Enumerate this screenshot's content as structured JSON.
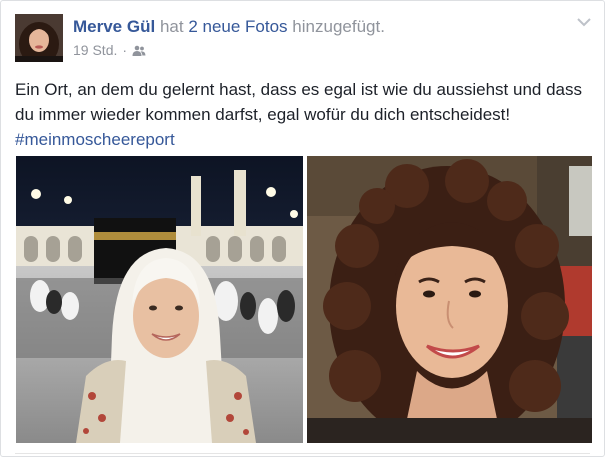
{
  "post": {
    "author": "Merve Gül",
    "action_prefix": "hat",
    "photos_link": "2 neue Fotos",
    "action_suffix": "hinzugefügt.",
    "timestamp": "19 Std.",
    "separator": "·",
    "audience_icon": "friends-icon",
    "options_icon": "chevron-down-icon",
    "text": "Ein Ort, an dem du gelernt hast, dass es egal ist wie du aussiehst und dass du immer wieder kommen darfst, egal wofür du dich entscheidest!",
    "hashtag": "#meinmoscheereport",
    "colors": {
      "link": "#365899",
      "meta": "#90949c",
      "text": "#1d2129"
    }
  }
}
